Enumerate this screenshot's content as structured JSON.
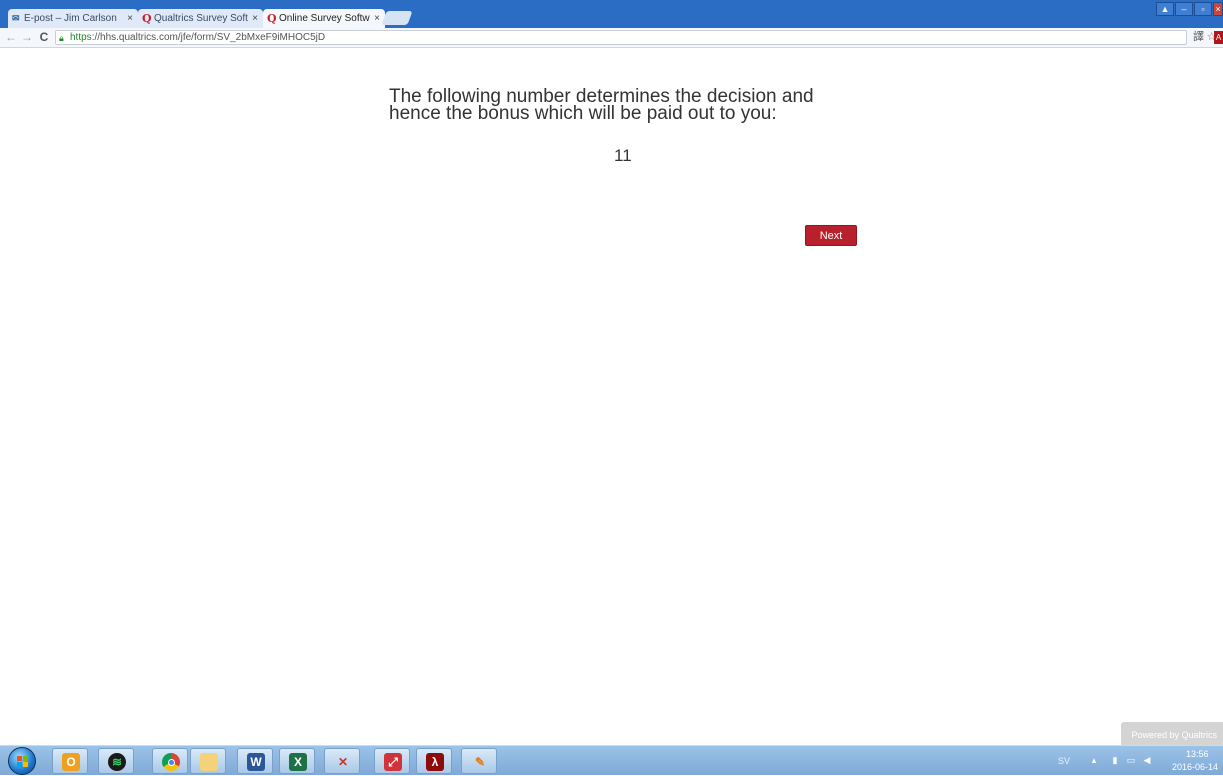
{
  "browser": {
    "tabs": [
      {
        "label": "E-post – Jim Carlson",
        "icon": "mail-icon",
        "active": false
      },
      {
        "label": "Qualtrics Survey Soft",
        "icon": "qualtrics-icon",
        "active": false
      },
      {
        "label": "Online Survey Softw",
        "icon": "qualtrics-icon",
        "active": true
      }
    ],
    "tab_close_glyph": "×",
    "url_scheme": "https",
    "url_rest": "://hhs.qualtrics.com/jfe/form/SV_2bMxeF9iMHOC5jD"
  },
  "survey": {
    "question_line1": "The following number determines the decision and",
    "question_line2": "hence the bonus which will be paid out to you:",
    "number": "11",
    "next_label": "Next",
    "powered_by": "Powered by Qualtrics"
  },
  "taskbar": {
    "language": "SV",
    "time": "13:56",
    "date": "2016-06-14",
    "pinned": [
      "outlook-icon",
      "spotify-icon",
      "chrome-icon",
      "file-explorer-icon",
      "word-icon",
      "excel-icon",
      "stata-icon",
      "pdf-viewer-icon",
      "acrobat-icon",
      "paint-icon"
    ]
  },
  "colors": {
    "tab_bar": "#2b6cc4",
    "next_button": "#b8202c",
    "taskbar": "#8db6df"
  }
}
